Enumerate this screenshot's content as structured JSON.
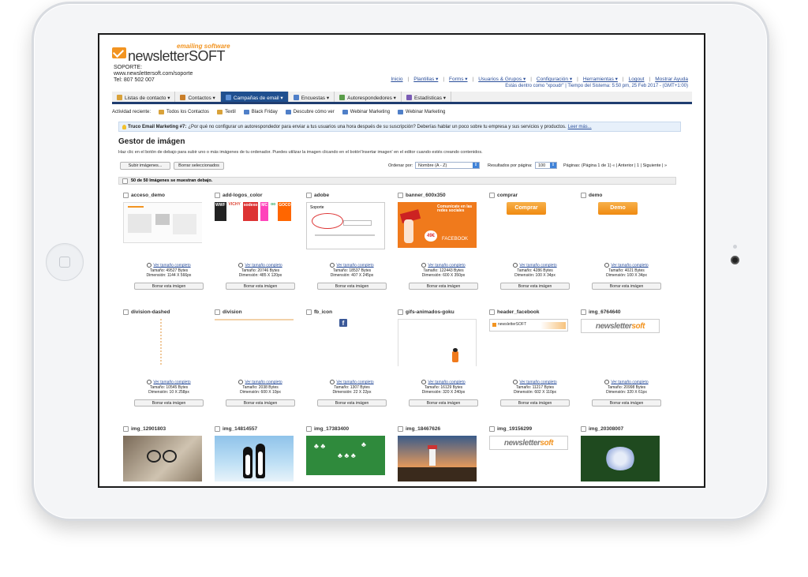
{
  "brand": {
    "tagline": "emailing software",
    "name": "newsletterSOFT",
    "support_label": "SOPORTE:",
    "support_url": "www.newslettersoft.com/soporte",
    "support_phone": "Tel: 807 502 007"
  },
  "toplinks": [
    "Inicio",
    "Plantillas ▾",
    "Forms ▾",
    "Usuarios & Grupos ▾",
    "Configuración ▾",
    "Herramientas ▾",
    "Logout",
    "Mostrar Ayuda"
  ],
  "session_info": "Estás dentro como \"xpoudr\" | Tiempo del Sistema: 5:50 pm, 25 Feb 2017 - (GMT+1:00)",
  "nav": [
    {
      "label": "Listas de contacto ▾",
      "color": "#d9a23a"
    },
    {
      "label": "Contactos ▾",
      "color": "#c97f2a"
    },
    {
      "label": "Campañas de email ▾",
      "color": "#5b8fd6",
      "active": true
    },
    {
      "label": "Encuestas ▾",
      "color": "#4f7fc8"
    },
    {
      "label": "Autorespondedores ▾",
      "color": "#5a9d4a"
    },
    {
      "label": "Estadísticas ▾",
      "color": "#7a5bb5"
    }
  ],
  "activity": {
    "label": "Actividad reciente:",
    "items": [
      "Todos los Contactos",
      "Textil",
      "Black Friday",
      "Descubre cómo ver",
      "Webinar Marketing",
      "Webinar Marketing"
    ]
  },
  "tip": {
    "bold": "Truco Email Marketing #7:",
    "text": "¿Por qué no configurar un autorespondedor para enviar a tus usuarios una hora después de su suscripción? Deberías hablar un poco sobre tu empresa y sus servicios y productos.",
    "link": "Leer más..."
  },
  "page": {
    "title": "Gestor de imágen",
    "help": "Haz clic en el botón de debajo para subir uno o más imágenes de tu ordenador. Puedes utilizar la imagen clicando en el botón'Insertar imagen' en el editor cuando estés creando contenidos."
  },
  "toolbar": {
    "upload": "Subir imágenes...",
    "delete_selected": "Borrar seleccionados",
    "sort_label": "Ordenar por:",
    "sort_value": "Nombre (A - Z)",
    "perpage_label": "Resultados por página:",
    "perpage_value": "100",
    "pages": "Páginas: (Página 1 de 1)   « | Anterior | 1 | Siguiente | »"
  },
  "count_text": "50 de 50 Imágenes se muestran debajo.",
  "labels": {
    "view_full": "Ver tamaño completo",
    "delete_image": "Borrar esta imágen"
  },
  "images": [
    {
      "name": "acceso_demo",
      "size": "Tamaño: 49527 Bytes",
      "dim": "Dimensión: 1144 X 566px",
      "kind": "screenshot"
    },
    {
      "name": "add-logos_color",
      "size": "Tamaño: 20746 Bytes",
      "dim": "Dimensión: 485 X 120px",
      "kind": "logos"
    },
    {
      "name": "adobe",
      "size": "Tamaño: 18537 Bytes",
      "dim": "Dimensión: 407 X 245px",
      "kind": "form",
      "text": "Soporte"
    },
    {
      "name": "banner_600x350",
      "size": "Tamaño: 122443 Bytes",
      "dim": "Dimensión: 600 X 350px",
      "kind": "banner",
      "text": "Comunícate en las redes sociales",
      "price": "49€",
      "fb": "FACEBOOK"
    },
    {
      "name": "comprar",
      "size": "Tamaño: 4286 Bytes",
      "dim": "Dimensión: 100 X 34px",
      "kind": "button",
      "text": "Comprar"
    },
    {
      "name": "demo",
      "size": "Tamaño: 4021 Bytes",
      "dim": "Dimensión: 100 X 34px",
      "kind": "button",
      "text": "Demo"
    },
    {
      "name": "division-dashed",
      "size": "Tamaño: 10545 Bytes",
      "dim": "Dimensión: 10 X 258px",
      "kind": "vline"
    },
    {
      "name": "division",
      "size": "Tamaño: 2038 Bytes",
      "dim": "Dimensión: 600 X 10px",
      "kind": "hline"
    },
    {
      "name": "fb_icon",
      "size": "Tamaño: 1307 Bytes",
      "dim": "Dimensión: 22 X 22px",
      "kind": "fbicon"
    },
    {
      "name": "gifs-animados-goku",
      "size": "Tamaño: 16129 Bytes",
      "dim": "Dimensión: 320 X 240px",
      "kind": "goku"
    },
    {
      "name": "header_facebook",
      "size": "Tamaño: 11217 Bytes",
      "dim": "Dimensión: 602 X 110px",
      "kind": "header"
    },
    {
      "name": "img_6764640",
      "size": "Tamaño: 20998 Bytes",
      "dim": "Dimensión: 320 X 61px",
      "kind": "logo"
    },
    {
      "name": "img_12901803",
      "kind": "photo-glasses"
    },
    {
      "name": "img_14814557",
      "kind": "photo-penguins"
    },
    {
      "name": "img_17383400",
      "kind": "photo-trees"
    },
    {
      "name": "img_18467626",
      "kind": "photo-lighthouse"
    },
    {
      "name": "img_19156299",
      "kind": "logo"
    },
    {
      "name": "img_20308007",
      "kind": "photo-flower"
    }
  ],
  "colors": {
    "accent": "#f29421",
    "nav_active": "#1f4f8f",
    "link": "#2a4e9a"
  }
}
